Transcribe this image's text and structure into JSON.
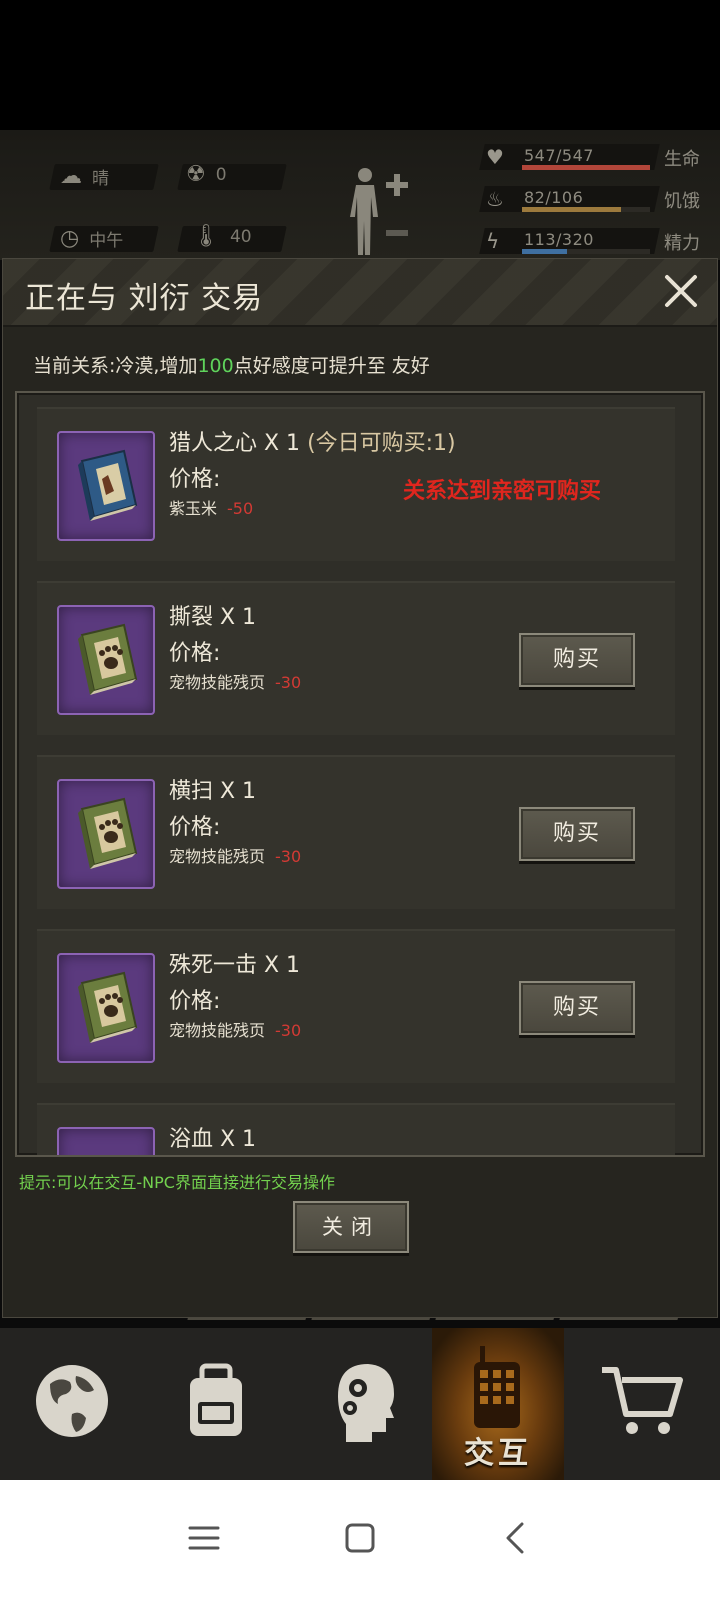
{
  "hud": {
    "weather": "晴",
    "radiation": "0",
    "time_of_day": "中午",
    "temperature": "40",
    "stats": [
      {
        "value": "547/547",
        "label": "生命",
        "fill": 1.0,
        "color": "#b2463a",
        "icon": "heart-icon"
      },
      {
        "value": "82/106",
        "label": "饥饿",
        "fill": 0.77,
        "color": "#9c7a3d",
        "icon": "stomach-icon"
      },
      {
        "value": "113/320",
        "label": "精力",
        "fill": 0.35,
        "color": "#3f6fa0",
        "icon": "energy-icon"
      }
    ]
  },
  "modal": {
    "title": "正在与 刘衍 交易",
    "relation_prefix": "当前关系:冷漠,增加",
    "relation_points": "100",
    "relation_suffix": "点好感度可提升至 友好",
    "price_label": "价格:",
    "items": [
      {
        "name": "猎人之心 X 1",
        "limit": "(今日可购买:1)",
        "currency": "紫玉米",
        "cost": "-50",
        "locked_text": "关系达到亲密可购买",
        "buy_label": "",
        "icon": "hunter-book-icon"
      },
      {
        "name": "撕裂 X 1",
        "limit": "",
        "currency": "宠物技能残页",
        "cost": "-30",
        "locked_text": "",
        "buy_label": "购买",
        "icon": "paw-book-icon"
      },
      {
        "name": "横扫 X 1",
        "limit": "",
        "currency": "宠物技能残页",
        "cost": "-30",
        "locked_text": "",
        "buy_label": "购买",
        "icon": "paw-book-icon"
      },
      {
        "name": "殊死一击 X 1",
        "limit": "",
        "currency": "宠物技能残页",
        "cost": "-30",
        "locked_text": "",
        "buy_label": "购买",
        "icon": "paw-book-icon"
      },
      {
        "name": "浴血 X 1",
        "limit": "",
        "currency": "",
        "cost": "",
        "locked_text": "",
        "buy_label": "",
        "icon": "paw-book-icon"
      }
    ],
    "hint": "提示:可以在交互-NPC界面直接进行交易操作",
    "close_label": "关闭"
  },
  "nav": {
    "active_label": "交互",
    "items": [
      "globe-icon",
      "backpack-icon",
      "head-gears-icon",
      "walkie-talkie-icon",
      "cart-icon"
    ]
  },
  "colors": {
    "accent_green": "#5fd35b",
    "cost_red": "#d23a34",
    "locked_red": "#e0261e",
    "item_icon_purple": "#5b3a7e"
  }
}
